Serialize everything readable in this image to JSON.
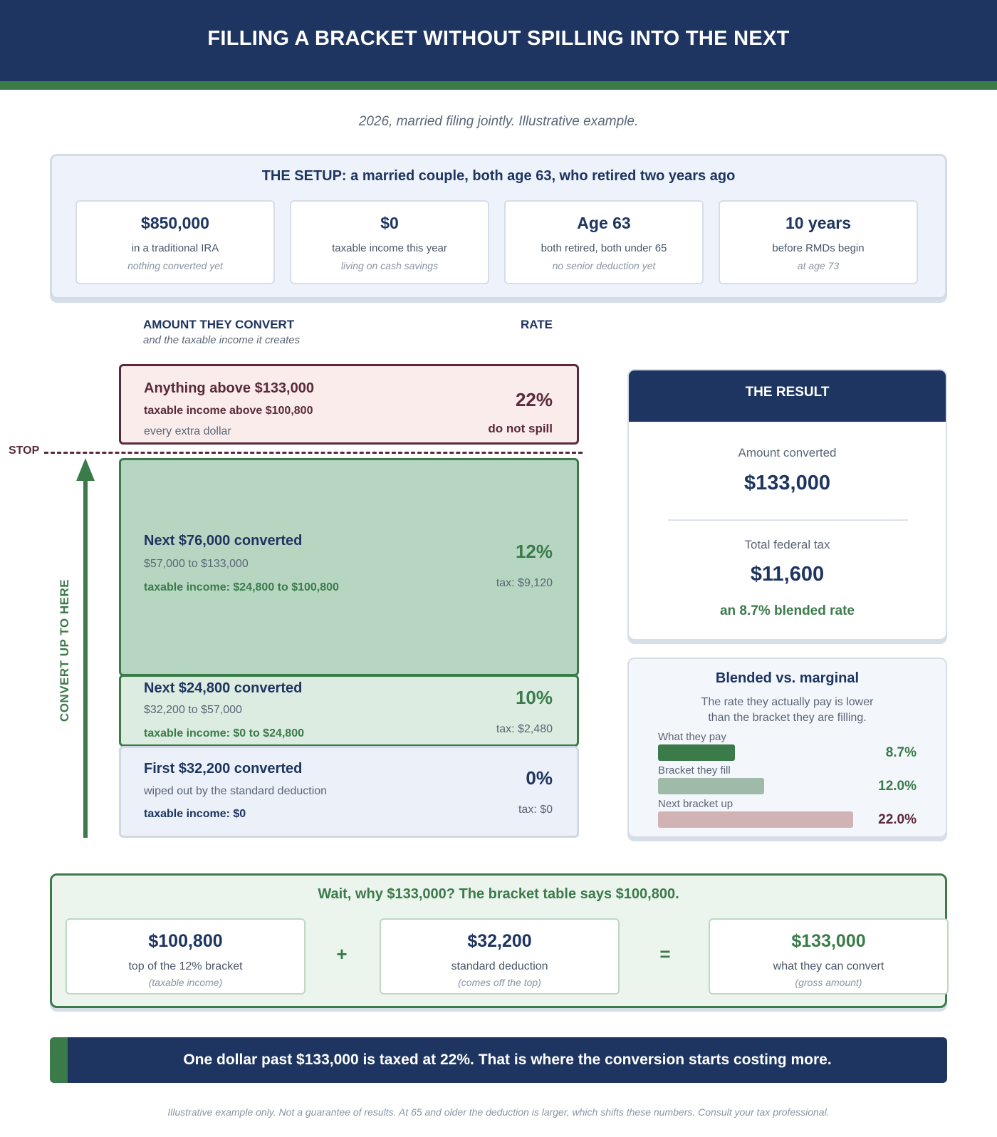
{
  "header": {
    "title": "FILLING A BRACKET WITHOUT SPILLING INTO THE NEXT"
  },
  "subtitle": "2026, married filing jointly. Illustrative example.",
  "setup": {
    "title": "THE SETUP: a married couple, both age 63, who retired two years ago",
    "cards": [
      {
        "value": "$850,000",
        "label": "in a traditional IRA",
        "note": "nothing converted yet"
      },
      {
        "value": "$0",
        "label": "taxable income this year",
        "note": "living on cash savings"
      },
      {
        "value": "Age 63",
        "label": "both retired, both under 65",
        "note": "no senior deduction yet"
      },
      {
        "value": "10 years",
        "label": "before RMDs begin",
        "note": "at age 73"
      }
    ]
  },
  "columns": {
    "amount_head": "AMOUNT THEY CONVERT",
    "amount_sub": "and the taxable income it creates",
    "rate_head": "RATE"
  },
  "stop_label": "STOP",
  "arrow_label": "CONVERT UP TO HERE",
  "brackets": [
    {
      "title": "Anything above $133,000",
      "bold": "taxable income above $100,800",
      "line": "every extra dollar",
      "rate": "22%",
      "note": "do not spill"
    },
    {
      "title": "Next $76,000 converted",
      "line": "$57,000 to $133,000",
      "bold": "taxable income: $24,800 to $100,800",
      "rate": "12%",
      "tax": "tax: $9,120"
    },
    {
      "title": "Next $24,800 converted",
      "line": "$32,200 to $57,000",
      "bold": "taxable income: $0 to $24,800",
      "rate": "10%",
      "tax": "tax: $2,480"
    },
    {
      "title": "First $32,200 converted",
      "line": "wiped out by the standard deduction",
      "bold": "taxable income: $0",
      "rate": "0%",
      "tax": "tax: $0"
    }
  ],
  "result": {
    "title": "THE RESULT",
    "converted_label": "Amount converted",
    "converted_value": "$133,000",
    "tax_label": "Total federal tax",
    "tax_value": "$11,600",
    "blended": "an 8.7% blended rate"
  },
  "blend": {
    "title": "Blended vs. marginal",
    "desc_line1": "The rate they actually pay is lower",
    "desc_line2": "than the bracket they are filling.",
    "bars": [
      {
        "label": "What they pay",
        "value": "8.7%",
        "pct": 8.7,
        "color": "#3b7b4a",
        "text_color": "#3b7b4a"
      },
      {
        "label": "Bracket they fill",
        "value": "12.0%",
        "pct": 12.0,
        "color": "#9fbaa9",
        "text_color": "#3b7b4a"
      },
      {
        "label": "Next bracket up",
        "value": "22.0%",
        "pct": 22.0,
        "color": "#d2b3b5",
        "text_color": "#5a2a3a"
      }
    ]
  },
  "why": {
    "title": "Wait, why $133,000? The bracket table says $100,800.",
    "cards": [
      {
        "value": "$100,800",
        "label": "top of the 12% bracket",
        "note": "(taxable income)"
      },
      {
        "value": "$32,200",
        "label": "standard deduction",
        "note": "(comes off the top)"
      },
      {
        "value": "$133,000",
        "label": "what they can convert",
        "note": "(gross amount)"
      }
    ],
    "plus": "+",
    "equals": "="
  },
  "banner": "One dollar past $133,000 is taxed at 22%. That is where the conversion starts costing more.",
  "footnote": "Illustrative example only. Not a guarantee of results. At 65 and older the deduction is larger, which shifts these numbers. Consult your tax professional.",
  "colors": {
    "navy": "#1d3560",
    "green": "#3b7b4a",
    "maroon": "#5a2a3a"
  }
}
